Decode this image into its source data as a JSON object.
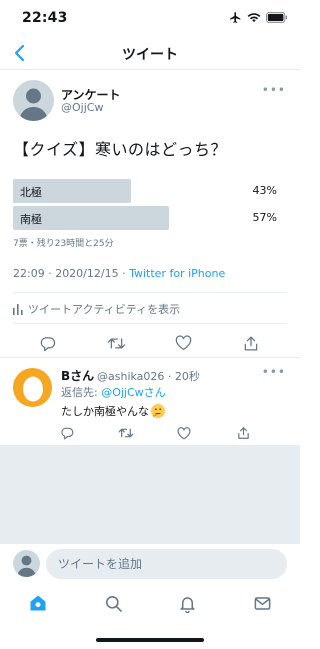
{
  "status_bar": {
    "time": "22:43",
    "icons": [
      "airplane-icon",
      "wifi-icon",
      "battery-icon"
    ]
  },
  "nav": {
    "title": "ツイート",
    "back_icon": "chevron-left-icon"
  },
  "tweet": {
    "author_name": "アンケート",
    "author_handle": "@OjjCw",
    "text": "【クイズ】寒いのはどっち？",
    "poll": {
      "options": [
        {
          "label": "北極",
          "percent": "43%",
          "share": 0.43
        },
        {
          "label": "南極",
          "percent": "57%",
          "share": 0.57
        }
      ],
      "meta": "7票・残り23時間と25分"
    },
    "date": "22:09 · 2020/12/15 · ",
    "source": "Twitter for iPhone",
    "activity_label": "ツイートアクティビティを表示",
    "actions": [
      "reply-icon",
      "retweet-icon",
      "like-icon",
      "share-icon"
    ]
  },
  "reply": {
    "name": "Bさん",
    "handle_time": "@ashika026 · 20秒",
    "reply_to_prefix": "返信先: ",
    "reply_to_handle": "@OjjCwさん",
    "text": "たしか南極やんな",
    "emoji": "thinking-face-emoji"
  },
  "compose": {
    "placeholder": "ツイートを追加"
  },
  "tabbar": {
    "tabs": [
      "home-icon",
      "search-icon",
      "notifications-icon",
      "messages-icon"
    ],
    "active_color": "#1da1f2"
  },
  "colors": {
    "accent": "#1da1f2",
    "poll_bar": "#ccd6dd",
    "muted_text": "#657786",
    "separator": "#e6ecf0"
  }
}
